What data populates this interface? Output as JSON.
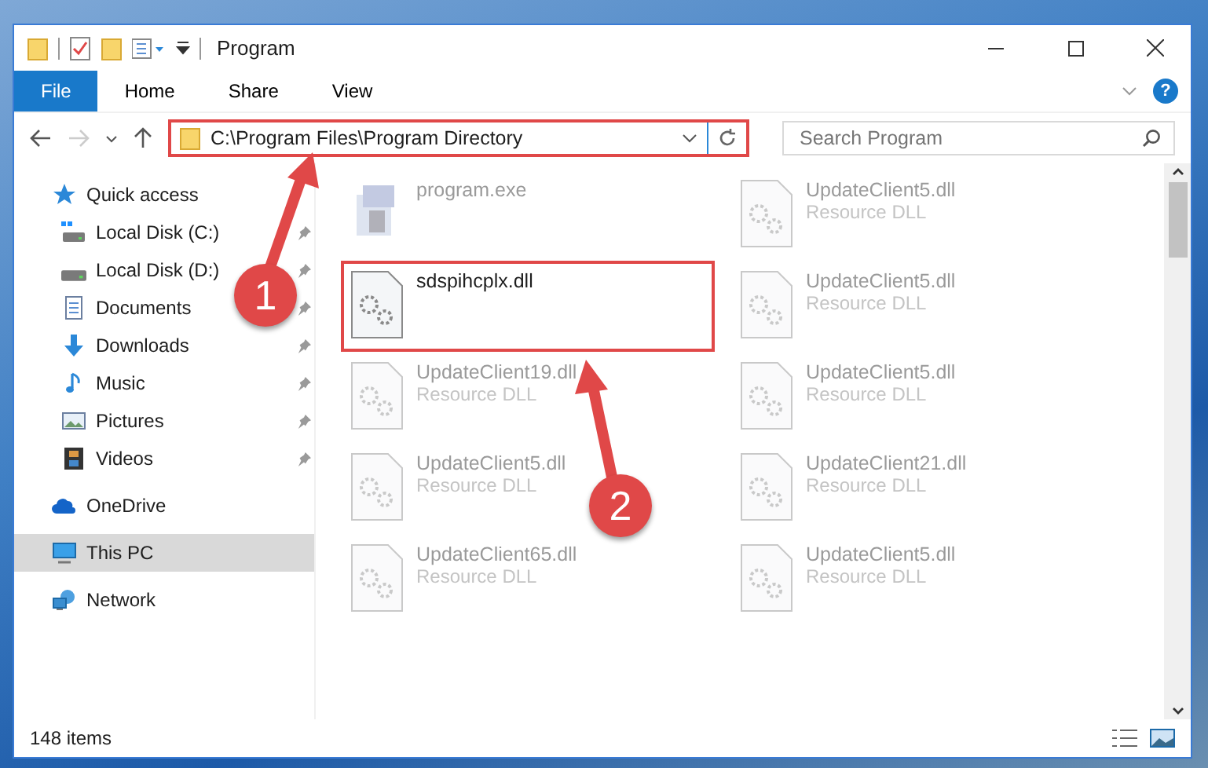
{
  "window": {
    "title": "Program"
  },
  "ribbon": {
    "tabs": [
      {
        "label": "File",
        "selected": true
      },
      {
        "label": "Home",
        "selected": false
      },
      {
        "label": "Share",
        "selected": false
      },
      {
        "label": "View",
        "selected": false
      }
    ],
    "help": "?"
  },
  "address": {
    "path": "C:\\Program Files\\Program Directory",
    "highlighted": true
  },
  "search": {
    "placeholder": "Search Program"
  },
  "sidebar": {
    "items": [
      {
        "label": "Quick access",
        "kind": "star",
        "selected": false,
        "children": [
          {
            "label": "Local Disk (C:)",
            "kind": "drive-c",
            "pinned": true,
            "selected": false
          },
          {
            "label": "Local Disk (D:)",
            "kind": "drive",
            "pinned": true,
            "selected": false
          },
          {
            "label": "Documents",
            "kind": "document",
            "pinned": true,
            "selected": false
          },
          {
            "label": "Downloads",
            "kind": "download",
            "pinned": true,
            "selected": false
          },
          {
            "label": "Music",
            "kind": "music",
            "pinned": true,
            "selected": false
          },
          {
            "label": "Pictures",
            "kind": "picture",
            "pinned": true,
            "selected": false
          },
          {
            "label": "Videos",
            "kind": "video",
            "pinned": true,
            "selected": false
          }
        ]
      },
      {
        "label": "OneDrive",
        "kind": "cloud",
        "selected": false
      },
      {
        "label": "This PC",
        "kind": "pc",
        "selected": true
      },
      {
        "label": "Network",
        "kind": "network",
        "selected": false
      }
    ]
  },
  "files": [
    {
      "name": "program.exe",
      "kind": "exe",
      "blurred": true,
      "highlighted": false
    },
    {
      "name": "UpdateClient5.dll",
      "type": "Resource DLL",
      "kind": "dll",
      "blurred": true,
      "highlighted": false
    },
    {
      "name": "sdspihcplx.dll",
      "kind": "dll",
      "blurred": false,
      "highlighted": true
    },
    {
      "name": "UpdateClient5.dll",
      "type": "Resource DLL",
      "kind": "dll",
      "blurred": true,
      "highlighted": false
    },
    {
      "name": "UpdateClient19.dll",
      "type": "Resource DLL",
      "kind": "dll",
      "blurred": true,
      "highlighted": false
    },
    {
      "name": "UpdateClient5.dll",
      "type": "Resource DLL",
      "kind": "dll",
      "blurred": true,
      "highlighted": false
    },
    {
      "name": "UpdateClient5.dll",
      "type": "Resource DLL",
      "kind": "dll",
      "blurred": true,
      "highlighted": false
    },
    {
      "name": "UpdateClient21.dll",
      "type": "Resource DLL",
      "kind": "dll",
      "blurred": true,
      "highlighted": false
    },
    {
      "name": "UpdateClient65.dll",
      "type": "Resource DLL",
      "kind": "dll",
      "blurred": true,
      "highlighted": false
    },
    {
      "name": "UpdateClient5.dll",
      "type": "Resource DLL",
      "kind": "dll",
      "blurred": true,
      "highlighted": false
    }
  ],
  "status_bar": {
    "count": "148 items"
  },
  "callouts": [
    {
      "label": "1"
    },
    {
      "label": "2"
    }
  ]
}
